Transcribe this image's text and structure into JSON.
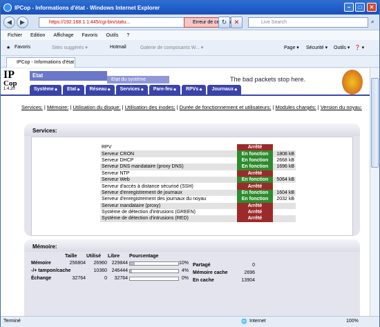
{
  "window": {
    "title": "IPCop - Informations d'état - Windows Internet Explorer"
  },
  "address": {
    "url": "https://192.168.1.1:445/cgi-bin/statu...",
    "cert_error": "Erreur de certificat",
    "search_placeholder": "Live Search"
  },
  "menu": [
    "Fichier",
    "Edition",
    "Affichage",
    "Favoris",
    "Outils",
    "?"
  ],
  "favorites": {
    "label": "Favoris",
    "suggested": "Sites suggérés ▾",
    "hotmail": "Hotmail",
    "gallery": "Galerie de composants W... ▾",
    "page": "Page ▾",
    "security": "Sécurité ▾",
    "tools": "Outils ▾",
    "help": "❓ ▾"
  },
  "tab": {
    "label": "IPCop - Informations d'état"
  },
  "ipcop": {
    "logo_top": "IP",
    "logo_bottom": "Cop",
    "version": "1.4.20",
    "section": "Etat",
    "subsection": "Etat du système",
    "slogan": "The bad packets stop here."
  },
  "nav": [
    "Système",
    "Etat",
    "Réseau",
    "Services",
    "Pare-feu",
    "RPVs",
    "Journaux"
  ],
  "links": [
    "Services:",
    "Mémoire:",
    "Utilisation du disque:",
    "Utilisation des inodes:",
    "Durée de fonctionnement et utilisateurs:",
    "Modules chargés:",
    "Version du noyau:"
  ],
  "services": {
    "title": "Services:",
    "rows": [
      {
        "name": "RPV",
        "status": "Arrêté",
        "state": "off",
        "mem": ""
      },
      {
        "name": "Serveur CRON",
        "status": "En fonction",
        "state": "on",
        "mem": "1808 kB"
      },
      {
        "name": "Serveur DHCP",
        "status": "En fonction",
        "state": "on",
        "mem": "2668 kB"
      },
      {
        "name": "Serveur DNS mandataire (proxy DNS)",
        "status": "En fonction",
        "state": "on",
        "mem": "1696 kB"
      },
      {
        "name": "Serveur NTP",
        "status": "Arrêté",
        "state": "off",
        "mem": ""
      },
      {
        "name": "Serveur Web",
        "status": "En fonction",
        "state": "on",
        "mem": "5064 kB"
      },
      {
        "name": "Serveur d'accès à distance sécurisé (SSH)",
        "status": "Arrêté",
        "state": "off",
        "mem": ""
      },
      {
        "name": "Serveur d'enregistrement de journaux",
        "status": "En fonction",
        "state": "on",
        "mem": "1604 kB"
      },
      {
        "name": "Serveur d'enregistrement des journaux du noyau",
        "status": "En fonction",
        "state": "on",
        "mem": "2032 kB"
      },
      {
        "name": "Serveur mandataire (proxy)",
        "status": "Arrêté",
        "state": "off",
        "mem": ""
      },
      {
        "name": "Système de détection d'intrusions (GREEN)",
        "status": "Arrêté",
        "state": "off",
        "mem": ""
      },
      {
        "name": "Système de détection d'intrusions (RED)",
        "status": "Arrêté",
        "state": "off",
        "mem": ""
      }
    ]
  },
  "memory": {
    "title": "Mémoire:",
    "headers": [
      "Taille",
      "Utilisé",
      "Libre",
      "Pourcentage"
    ],
    "rows": [
      {
        "label": "Mémoire",
        "size": "256804",
        "used": "26960",
        "free": "229844",
        "pct": "10%",
        "fill": 0.1
      },
      {
        "label": "-/+ tampon/cache",
        "size": "",
        "used": "10360",
        "free": "246444",
        "pct": "4%",
        "fill": 0.04
      },
      {
        "label": "Échange",
        "size": "32764",
        "used": "0",
        "free": "32764",
        "pct": "0%",
        "fill": 0
      }
    ],
    "extra": [
      {
        "label": "Partagé",
        "value": "0"
      },
      {
        "label": "Mémoire cache",
        "value": "2696"
      },
      {
        "label": "En cache",
        "value": "13904"
      }
    ]
  },
  "status": {
    "left": "Terminé",
    "zone": "Internet",
    "zoom": "100%"
  }
}
